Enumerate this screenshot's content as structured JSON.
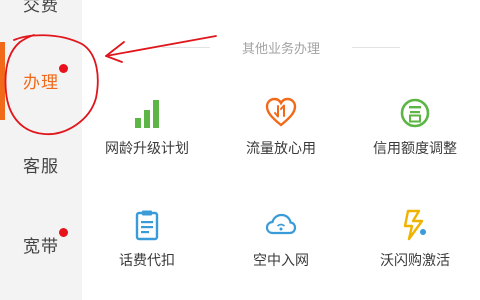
{
  "sidebar": {
    "items": [
      {
        "label": "交费",
        "active": false,
        "badge": false
      },
      {
        "label": "办理",
        "active": true,
        "badge": true
      },
      {
        "label": "客服",
        "active": false,
        "badge": false
      },
      {
        "label": "宽带",
        "active": false,
        "badge": true
      }
    ]
  },
  "main": {
    "section_title": "其他业务办理",
    "items": [
      {
        "label": "网龄升级计划",
        "icon": "signal-bars-icon"
      },
      {
        "label": "流量放心用",
        "icon": "heart-transfer-icon"
      },
      {
        "label": "信用额度调整",
        "icon": "credit-circle-icon"
      },
      {
        "label": "话费代扣",
        "icon": "clipboard-icon"
      },
      {
        "label": "空中入网",
        "icon": "cloud-wifi-icon"
      },
      {
        "label": "沃闪购激活",
        "icon": "lightning-icon"
      }
    ]
  },
  "colors": {
    "accent": "#f06a1a",
    "badge": "#e8121c",
    "sidebar_bg": "#f3f3f3",
    "green": "#5cb544",
    "blue": "#3a9bd9",
    "yellow": "#f0b400",
    "annotation": "#e0161c"
  },
  "annotation": {
    "icon": "hand-drawn-circle-arrow"
  }
}
